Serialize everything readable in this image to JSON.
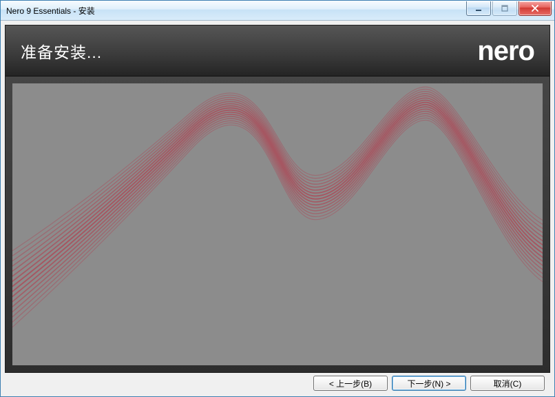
{
  "window": {
    "title": "Nero 9 Essentials - 安装"
  },
  "header": {
    "title": "准备安装...",
    "logo_text": "nero"
  },
  "footer": {
    "back_label": "< 上一步(B)",
    "next_label": "下一步(N) >",
    "cancel_label": "取消(C)"
  }
}
